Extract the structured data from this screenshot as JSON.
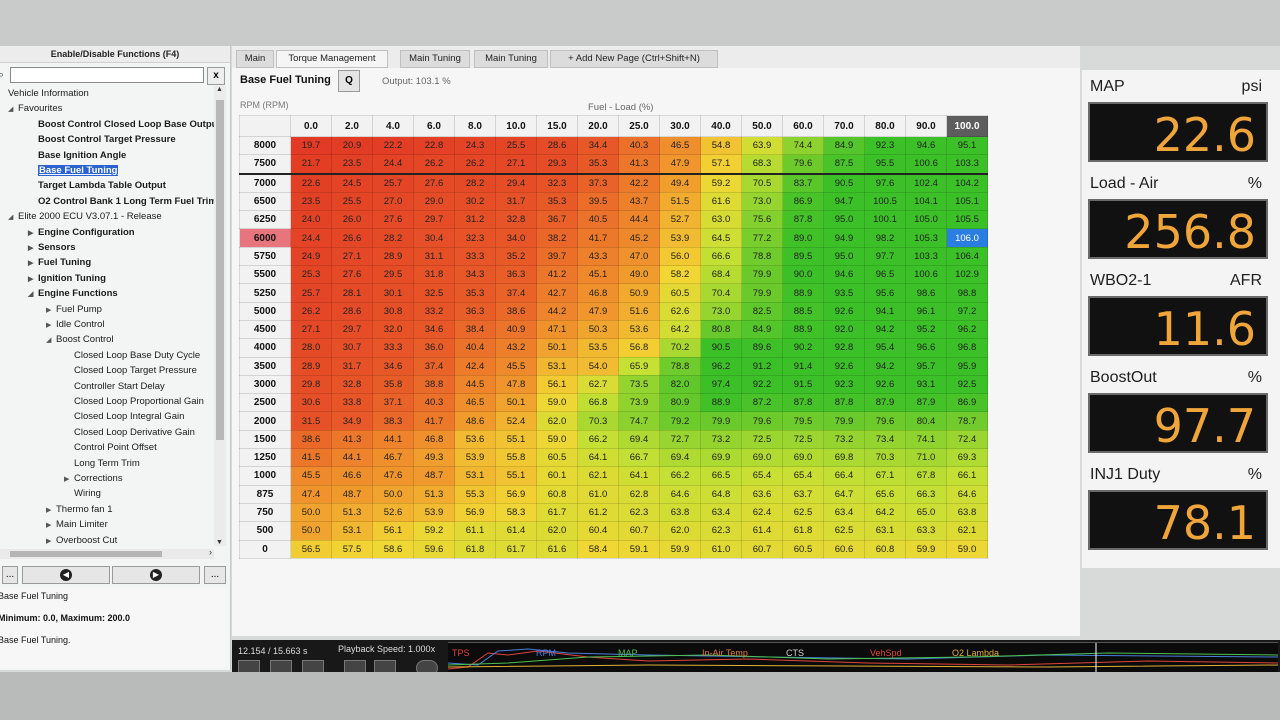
{
  "left_panel": {
    "header": "Enable/Disable Functions (F4)",
    "search_value": "",
    "clear_label": "x",
    "tree": [
      {
        "label": "Vehicle Information",
        "level": 0,
        "arrow": "",
        "bold": false
      },
      {
        "label": "Favourites",
        "level": 0,
        "arrow": "◢",
        "bold": false
      },
      {
        "label": "Boost Control Closed Loop Base Output",
        "level": 1,
        "arrow": "",
        "bold": true
      },
      {
        "label": "Boost Control Target Pressure",
        "level": 1,
        "arrow": "",
        "bold": true
      },
      {
        "label": "Base Ignition Angle",
        "level": 1,
        "arrow": "",
        "bold": true
      },
      {
        "label": "Base Fuel Tuning",
        "level": 1,
        "arrow": "",
        "bold": true,
        "selected": true
      },
      {
        "label": "Target Lambda Table Output",
        "level": 1,
        "arrow": "",
        "bold": true
      },
      {
        "label": "O2 Control Bank 1 Long Term Fuel Trim",
        "level": 1,
        "arrow": "",
        "bold": true
      },
      {
        "label": "Elite 2000 ECU V3.07.1 - Release",
        "level": 0,
        "arrow": "◢",
        "bold": false
      },
      {
        "label": "Engine Configuration",
        "level": 1,
        "arrow": "▶",
        "bold": true
      },
      {
        "label": "Sensors",
        "level": 1,
        "arrow": "▶",
        "bold": true
      },
      {
        "label": "Fuel Tuning",
        "level": 1,
        "arrow": "▶",
        "bold": true
      },
      {
        "label": "Ignition Tuning",
        "level": 1,
        "arrow": "▶",
        "bold": true
      },
      {
        "label": "Engine Functions",
        "level": 1,
        "arrow": "◢",
        "bold": true
      },
      {
        "label": "Fuel Pump",
        "level": 2,
        "arrow": "▶",
        "bold": false
      },
      {
        "label": "Idle Control",
        "level": 2,
        "arrow": "▶",
        "bold": false
      },
      {
        "label": "Boost Control",
        "level": 2,
        "arrow": "◢",
        "bold": false
      },
      {
        "label": "Closed Loop Base Duty Cycle",
        "level": 3,
        "arrow": "",
        "bold": false
      },
      {
        "label": "Closed Loop Target Pressure",
        "level": 3,
        "arrow": "",
        "bold": false
      },
      {
        "label": "Controller Start Delay",
        "level": 3,
        "arrow": "",
        "bold": false
      },
      {
        "label": "Closed Loop Proportional Gain",
        "level": 3,
        "arrow": "",
        "bold": false
      },
      {
        "label": "Closed Loop Integral Gain",
        "level": 3,
        "arrow": "",
        "bold": false
      },
      {
        "label": "Closed Loop Derivative Gain",
        "level": 3,
        "arrow": "",
        "bold": false
      },
      {
        "label": "Control Point Offset",
        "level": 3,
        "arrow": "",
        "bold": false
      },
      {
        "label": "Long Term Trim",
        "level": 3,
        "arrow": "",
        "bold": false
      },
      {
        "label": "Corrections",
        "level": 3,
        "arrow": "▶",
        "bold": false
      },
      {
        "label": "Wiring",
        "level": 3,
        "arrow": "",
        "bold": false
      },
      {
        "label": "Thermo fan 1",
        "level": 2,
        "arrow": "▶",
        "bold": false
      },
      {
        "label": "Main Limiter",
        "level": 2,
        "arrow": "▶",
        "bold": false
      },
      {
        "label": "Overboost Cut",
        "level": 2,
        "arrow": "▶",
        "bold": false
      }
    ],
    "nav": {
      "left": "...",
      "back": "◀",
      "forward": "▶",
      "right": "..."
    },
    "desc_title": "Base Fuel Tuning",
    "desc_range": "Minimum: 0.0, Maximum: 200.0",
    "desc_text": "Base Fuel Tuning."
  },
  "tabs": [
    "Main",
    "Torque Management",
    "Main Tuning",
    "Main Tuning",
    "+ Add New Page (Ctrl+Shift+N)"
  ],
  "table_header": {
    "title": "Base Fuel Tuning",
    "q_button": "Q",
    "output": "Output: 103.1 %",
    "rpm_axis": "RPM (RPM)",
    "load_axis": "Fuel - Load (%)"
  },
  "fuel_table": {
    "columns": [
      "0.0",
      "2.0",
      "4.0",
      "6.0",
      "8.0",
      "10.0",
      "15.0",
      "20.0",
      "25.0",
      "30.0",
      "40.0",
      "50.0",
      "60.0",
      "70.0",
      "80.0",
      "90.0",
      "100.0"
    ],
    "highlight_col": 16,
    "highlight_row": 5,
    "cursor": [
      5,
      16
    ],
    "rows": [
      {
        "rpm": "8000",
        "values": [
          "19.7",
          "20.9",
          "22.2",
          "22.8",
          "24.3",
          "25.5",
          "28.6",
          "34.4",
          "40.3",
          "46.5",
          "54.8",
          "63.9",
          "74.4",
          "84.9",
          "92.3",
          "94.6",
          "95.1"
        ]
      },
      {
        "rpm": "7500",
        "values": [
          "21.7",
          "23.5",
          "24.4",
          "26.2",
          "26.2",
          "27.1",
          "29.3",
          "35.3",
          "41.3",
          "47.9",
          "57.1",
          "68.3",
          "79.6",
          "87.5",
          "95.5",
          "100.6",
          "103.3"
        ]
      },
      {
        "rpm": "7000",
        "values": [
          "22.6",
          "24.5",
          "25.7",
          "27.6",
          "28.2",
          "29.4",
          "32.3",
          "37.3",
          "42.2",
          "49.4",
          "59.2",
          "70.5",
          "83.7",
          "90.5",
          "97.6",
          "102.4",
          "104.2"
        ]
      },
      {
        "rpm": "6500",
        "values": [
          "23.5",
          "25.5",
          "27.0",
          "29.0",
          "30.2",
          "31.7",
          "35.3",
          "39.5",
          "43.7",
          "51.5",
          "61.6",
          "73.0",
          "86.9",
          "94.7",
          "100.5",
          "104.1",
          "105.1"
        ]
      },
      {
        "rpm": "6250",
        "values": [
          "24.0",
          "26.0",
          "27.6",
          "29.7",
          "31.2",
          "32.8",
          "36.7",
          "40.5",
          "44.4",
          "52.7",
          "63.0",
          "75.6",
          "87.8",
          "95.0",
          "100.1",
          "105.0",
          "105.5"
        ]
      },
      {
        "rpm": "6000",
        "values": [
          "24.4",
          "26.6",
          "28.2",
          "30.4",
          "32.3",
          "34.0",
          "38.2",
          "41.7",
          "45.2",
          "53.9",
          "64.5",
          "77.2",
          "89.0",
          "94.9",
          "98.2",
          "105.3",
          "106.0"
        ]
      },
      {
        "rpm": "5750",
        "values": [
          "24.9",
          "27.1",
          "28.9",
          "31.1",
          "33.3",
          "35.2",
          "39.7",
          "43.3",
          "47.0",
          "56.0",
          "66.6",
          "78.8",
          "89.5",
          "95.0",
          "97.7",
          "103.3",
          "106.4"
        ]
      },
      {
        "rpm": "5500",
        "values": [
          "25.3",
          "27.6",
          "29.5",
          "31.8",
          "34.3",
          "36.3",
          "41.2",
          "45.1",
          "49.0",
          "58.2",
          "68.4",
          "79.9",
          "90.0",
          "94.6",
          "96.5",
          "100.6",
          "102.9"
        ]
      },
      {
        "rpm": "5250",
        "values": [
          "25.7",
          "28.1",
          "30.1",
          "32.5",
          "35.3",
          "37.4",
          "42.7",
          "46.8",
          "50.9",
          "60.5",
          "70.4",
          "79.9",
          "88.9",
          "93.5",
          "95.6",
          "98.6",
          "98.8"
        ]
      },
      {
        "rpm": "5000",
        "values": [
          "26.2",
          "28.6",
          "30.8",
          "33.2",
          "36.3",
          "38.6",
          "44.2",
          "47.9",
          "51.6",
          "62.6",
          "73.0",
          "82.5",
          "88.5",
          "92.6",
          "94.1",
          "96.1",
          "97.2"
        ]
      },
      {
        "rpm": "4500",
        "values": [
          "27.1",
          "29.7",
          "32.0",
          "34.6",
          "38.4",
          "40.9",
          "47.1",
          "50.3",
          "53.6",
          "64.2",
          "80.8",
          "84.9",
          "88.9",
          "92.0",
          "94.2",
          "95.2",
          "96.2"
        ]
      },
      {
        "rpm": "4000",
        "values": [
          "28.0",
          "30.7",
          "33.3",
          "36.0",
          "40.4",
          "43.2",
          "50.1",
          "53.5",
          "56.8",
          "70.2",
          "90.5",
          "89.6",
          "90.2",
          "92.8",
          "95.4",
          "96.6",
          "96.8"
        ]
      },
      {
        "rpm": "3500",
        "values": [
          "28.9",
          "31.7",
          "34.6",
          "37.4",
          "42.4",
          "45.5",
          "53.1",
          "54.0",
          "65.9",
          "78.8",
          "96.2",
          "91.2",
          "91.4",
          "92.6",
          "94.2",
          "95.7",
          "95.9"
        ]
      },
      {
        "rpm": "3000",
        "values": [
          "29.8",
          "32.8",
          "35.8",
          "38.8",
          "44.5",
          "47.8",
          "56.1",
          "62.7",
          "73.5",
          "82.0",
          "97.4",
          "92.2",
          "91.5",
          "92.3",
          "92.6",
          "93.1",
          "92.5"
        ]
      },
      {
        "rpm": "2500",
        "values": [
          "30.6",
          "33.8",
          "37.1",
          "40.3",
          "46.5",
          "50.1",
          "59.0",
          "66.8",
          "73.9",
          "80.9",
          "88.9",
          "87.2",
          "87.8",
          "87.8",
          "87.9",
          "87.9",
          "86.9"
        ]
      },
      {
        "rpm": "2000",
        "values": [
          "31.5",
          "34.9",
          "38.3",
          "41.7",
          "48.6",
          "52.4",
          "62.0",
          "70.3",
          "74.7",
          "79.2",
          "79.9",
          "79.6",
          "79.5",
          "79.9",
          "79.6",
          "80.4",
          "78.7"
        ]
      },
      {
        "rpm": "1500",
        "values": [
          "38.6",
          "41.3",
          "44.1",
          "46.8",
          "53.6",
          "55.1",
          "59.0",
          "66.2",
          "69.4",
          "72.7",
          "73.2",
          "72.5",
          "72.5",
          "73.2",
          "73.4",
          "74.1",
          "72.4"
        ]
      },
      {
        "rpm": "1250",
        "values": [
          "41.5",
          "44.1",
          "46.7",
          "49.3",
          "53.9",
          "55.8",
          "60.5",
          "64.1",
          "66.7",
          "69.4",
          "69.9",
          "69.0",
          "69.0",
          "69.8",
          "70.3",
          "71.0",
          "69.3"
        ]
      },
      {
        "rpm": "1000",
        "values": [
          "45.5",
          "46.6",
          "47.6",
          "48.7",
          "53.1",
          "55.1",
          "60.1",
          "62.1",
          "64.1",
          "66.2",
          "66.5",
          "65.4",
          "65.4",
          "66.4",
          "67.1",
          "67.8",
          "66.1"
        ]
      },
      {
        "rpm": "875",
        "values": [
          "47.4",
          "48.7",
          "50.0",
          "51.3",
          "55.3",
          "56.9",
          "60.8",
          "61.0",
          "62.8",
          "64.6",
          "64.8",
          "63.6",
          "63.7",
          "64.7",
          "65.6",
          "66.3",
          "64.6"
        ]
      },
      {
        "rpm": "750",
        "values": [
          "50.0",
          "51.3",
          "52.6",
          "53.9",
          "56.9",
          "58.3",
          "61.7",
          "61.2",
          "62.3",
          "63.8",
          "63.4",
          "62.4",
          "62.5",
          "63.4",
          "64.2",
          "65.0",
          "63.8"
        ]
      },
      {
        "rpm": "500",
        "values": [
          "50.0",
          "53.1",
          "56.1",
          "59.2",
          "61.1",
          "61.4",
          "62.0",
          "60.4",
          "60.7",
          "62.0",
          "62.3",
          "61.4",
          "61.8",
          "62.5",
          "63.1",
          "63.3",
          "62.1"
        ]
      },
      {
        "rpm": "0",
        "values": [
          "56.5",
          "57.5",
          "58.6",
          "59.6",
          "61.8",
          "61.7",
          "61.6",
          "58.4",
          "59.1",
          "59.9",
          "61.0",
          "60.7",
          "60.5",
          "60.6",
          "60.8",
          "59.9",
          "59.0"
        ]
      }
    ]
  },
  "gauges": [
    {
      "name": "MAP",
      "unit": "psi",
      "value": "22.6"
    },
    {
      "name": "Load - Air",
      "unit": "%",
      "value": "256.8"
    },
    {
      "name": "WBO2-1",
      "unit": "AFR",
      "value": "11.6"
    },
    {
      "name": "BoostOut",
      "unit": "%",
      "value": "97.7"
    },
    {
      "name": "INJ1 Duty",
      "unit": "%",
      "value": "78.1"
    }
  ],
  "playback": {
    "time": "12.154 / 15.663 s",
    "speed": "Playback Speed: 1.000x",
    "channels": [
      {
        "name": "TPS",
        "color": "#e0453a"
      },
      {
        "name": "RPM",
        "color": "#4a7ee0"
      },
      {
        "name": "MAP",
        "color": "#4ec04e"
      },
      {
        "name": "In-Air Temp",
        "color": "#e07a3a"
      },
      {
        "name": "CTS",
        "color": "#d2d2d2"
      },
      {
        "name": "VehSpd",
        "color": "#e0453a"
      },
      {
        "name": "O2 Lambda",
        "color": "#e0b03a"
      }
    ]
  },
  "colors": {
    "cell_low": "#e8442a",
    "cell_mid": "#f2e63a",
    "cell_high": "#3cc43a",
    "cursor": "#2a7de1",
    "gauge_value": "#f0a53a"
  }
}
